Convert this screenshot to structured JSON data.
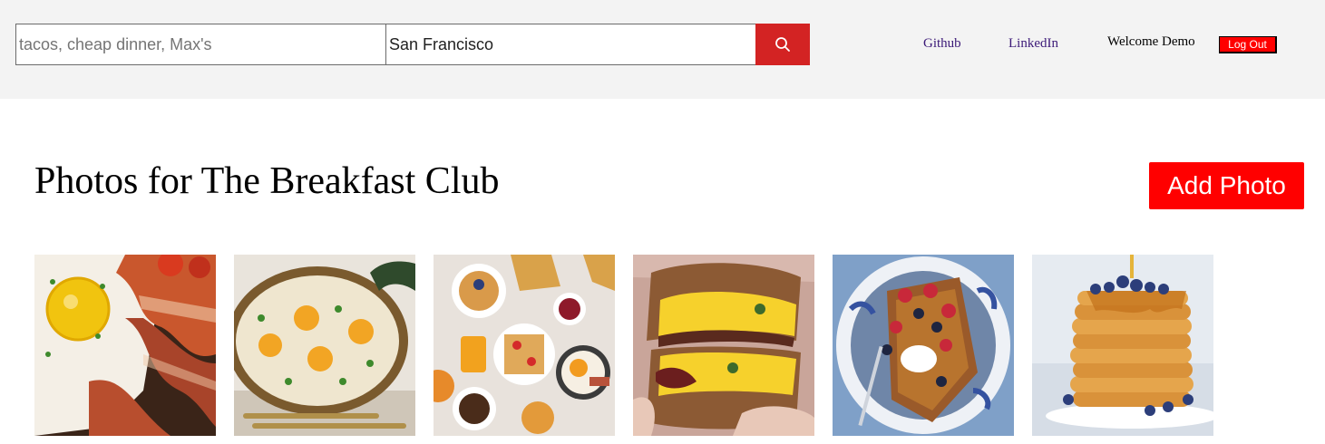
{
  "header": {
    "search": {
      "find_placeholder": "tacos, cheap dinner, Max's",
      "near_value": "San Francisco"
    },
    "nav": {
      "github_label": "Github",
      "linkedin_label": "LinkedIn",
      "welcome_text": "Welcome Demo",
      "logout_label": "Log Out"
    }
  },
  "main": {
    "title": "Photos for The Breakfast Club",
    "add_photo_label": "Add Photo",
    "photos": [
      {
        "subject": "fried egg and bacon"
      },
      {
        "subject": "baked eggs skillet"
      },
      {
        "subject": "breakfast spread"
      },
      {
        "subject": "breakfast sandwich"
      },
      {
        "subject": "french toast with berries"
      },
      {
        "subject": "blueberry pancake stack"
      }
    ]
  },
  "colors": {
    "header_bg": "#f3f3f3",
    "search_button": "#d32323",
    "accent_red": "#ff0000",
    "nav_link": "#3c1a78"
  }
}
